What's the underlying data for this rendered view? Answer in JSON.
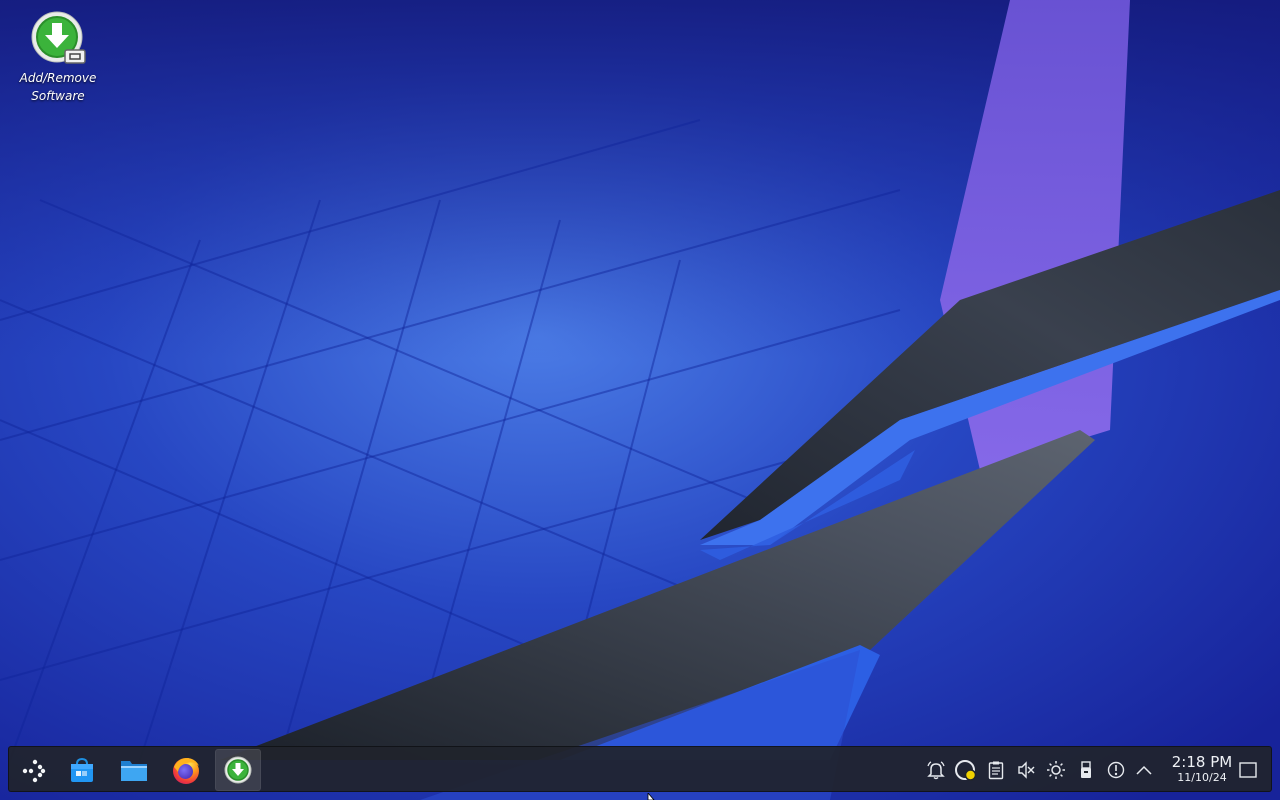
{
  "desktop": {
    "icons": [
      {
        "label_line1": "Add/Remove",
        "label_line2": "Software",
        "icon": "software-install-icon"
      }
    ]
  },
  "taskbar": {
    "launcher_icon": "application-launcher-icon",
    "tasks": [
      {
        "icon": "discover-store-icon",
        "active": false
      },
      {
        "icon": "file-manager-icon",
        "active": false
      },
      {
        "icon": "firefox-icon",
        "active": false
      },
      {
        "icon": "add-remove-software-icon",
        "active": true
      }
    ],
    "tray": [
      "notifications-bell-icon",
      "update-status-icon",
      "clipboard-icon",
      "volume-muted-icon",
      "brightness-icon",
      "removable-device-icon",
      "network-icon",
      "show-hidden-arrow-icon"
    ],
    "clock": {
      "time": "2:18 PM",
      "date": "11/10/24"
    },
    "show_desktop_icon": "show-desktop-icon"
  },
  "colors": {
    "wallpaper_base": "#1a2f9a",
    "wallpaper_purple": "#7d5ce0",
    "ribbon_dark": "#2b323f",
    "ribbon_blue": "#3a6ee8",
    "panel": "#20242c",
    "update_badge": "#f1d200"
  }
}
